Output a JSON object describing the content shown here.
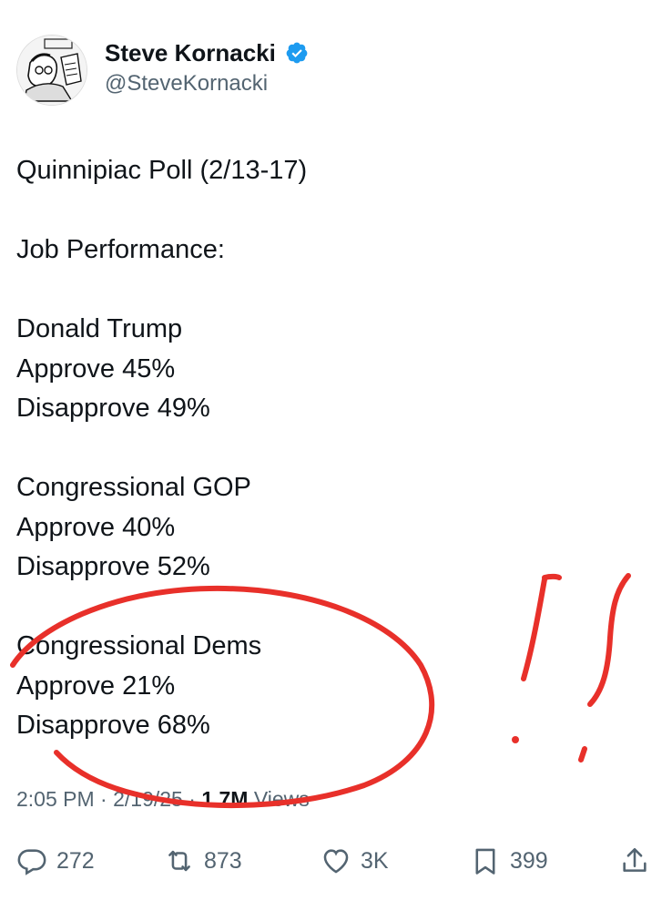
{
  "author": {
    "display_name": "Steve Kornacki",
    "handle": "@SteveKornacki"
  },
  "tweet": {
    "lines": [
      "Quinnipiac Poll (2/13-17)",
      "",
      "Job Performance:",
      "",
      "Donald Trump",
      "Approve 45%",
      "Disapprove 49%",
      "",
      "Congressional GOP",
      "Approve 40%",
      "Disapprove 52%",
      "",
      "Congressional Dems",
      "Approve 21%",
      "Disapprove 68%"
    ]
  },
  "meta": {
    "time": "2:05 PM",
    "sep1": " · ",
    "date": "2/19/25",
    "sep2": " · ",
    "views_count": "1.7M",
    "views_label": " Views"
  },
  "actions": {
    "replies": "272",
    "reposts": "873",
    "likes": "3K",
    "bookmarks": "399"
  },
  "colors": {
    "annotation": "#e8302a",
    "verified": "#1d9bf0",
    "secondary_text": "#536471"
  },
  "icons": [
    "reply-icon",
    "repost-icon",
    "like-icon",
    "bookmark-icon",
    "share-icon",
    "verified-badge-icon"
  ]
}
